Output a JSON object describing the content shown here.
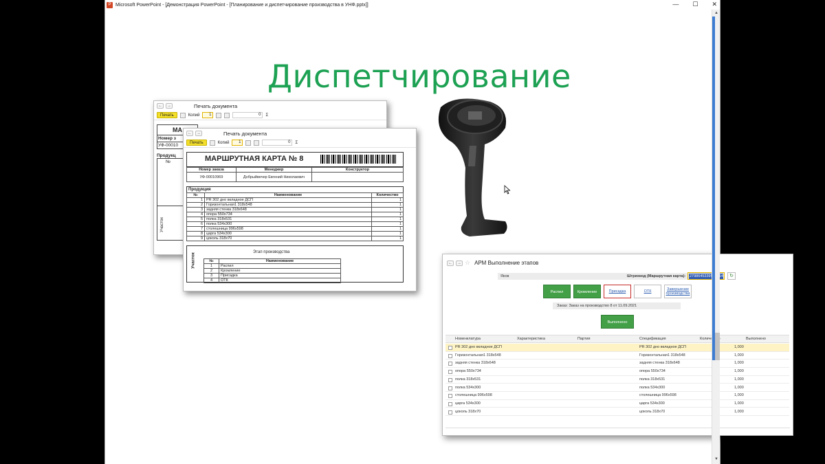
{
  "window": {
    "title": "Microsoft PowerPoint - [Демонстрация PowerPoint - [Планирование и диспетчирование производства в УНФ.pptx]]",
    "min": "—",
    "max": "☐",
    "close": "✕"
  },
  "slide": {
    "title": "Диспетчирование"
  },
  "doc_back": {
    "title": "Печать документа",
    "print_label": "Печать",
    "copies_label": "Копий",
    "copies": "1",
    "num": "0",
    "sigma": "Σ",
    "header_partial": "МА",
    "num_label": "Номер з",
    "order": "УФ-00010",
    "prod_label": "Продукц",
    "col_n": "№",
    "col_uch": "Участок"
  },
  "doc_front": {
    "title": "Печать документа",
    "print_label": "Печать",
    "copies_label": "Копий",
    "copies": "1",
    "num": "0",
    "sigma": "Σ",
    "heading": "МАРШРУТНАЯ КАРТА № 8",
    "order_head": "Номер заказа",
    "manager_head": "Менеджер",
    "constructor_head": "Конструктор",
    "order": "УФ-00010969",
    "manager": "Добрыйвечер Евгений Николаевич",
    "products_label": "Продукция",
    "col_n": "№",
    "col_name": "Наименование",
    "col_qty": "Количество",
    "products": [
      {
        "n": "1",
        "name": "PR 302 дно вкладное ДСП",
        "qty": "1"
      },
      {
        "n": "2",
        "name": "Горизонтальная1 318х548",
        "qty": "1"
      },
      {
        "n": "3",
        "name": "задняя стенка 318х648",
        "qty": "1"
      },
      {
        "n": "4",
        "name": "опора 550х734",
        "qty": "1"
      },
      {
        "n": "5",
        "name": "полка 318х531",
        "qty": "1"
      },
      {
        "n": "6",
        "name": "полка 534х300",
        "qty": "1"
      },
      {
        "n": "7",
        "name": "столешница 996х598",
        "qty": "1"
      },
      {
        "n": "8",
        "name": "царга 534х300",
        "qty": "1"
      },
      {
        "n": "9",
        "name": "цоколь 318х70",
        "qty": "1"
      }
    ],
    "uch_label": "Участок",
    "stage_label": "Этап производства",
    "stage_col_n": "№",
    "stage_col_name": "Наименование",
    "stages": [
      {
        "n": "1",
        "name": "Распил"
      },
      {
        "n": "2",
        "name": "Кромление"
      },
      {
        "n": "3",
        "name": "Присадка"
      },
      {
        "n": "4",
        "name": "ОТК"
      }
    ]
  },
  "arm": {
    "title": "АРМ Выполнение этапов",
    "user": "Яков",
    "barcode_label": "Штрихкод (Маршрутная карта):",
    "barcode_value": "2798645339577714",
    "buttons": [
      "Распил",
      "Кромление",
      "Присадка",
      "ОТК",
      "Завершение производства"
    ],
    "order_info": "Заказ: Заказ на производство 8 от 11.09.2021",
    "exec_button": "Выполнено",
    "cols": [
      "Номенклатура",
      "Характеристика",
      "Партия",
      "Спецификация",
      "Количество",
      "Выполнено"
    ],
    "rows": [
      {
        "name": "PR 302 дно вкладное ДСП",
        "spec": "PR 302 дно вкладное ДСП",
        "qty": "1,000"
      },
      {
        "name": "Горизонтальная1 318х548",
        "spec": "Горизонтальная1 318х548",
        "qty": "1,000"
      },
      {
        "name": "задняя стенка 318х648",
        "spec": "задняя стенка 318х648",
        "qty": "1,000"
      },
      {
        "name": "опора 550х734",
        "spec": "опора 550х734",
        "qty": "1,000"
      },
      {
        "name": "полка 318х531",
        "spec": "полка 318х531",
        "qty": "1,000"
      },
      {
        "name": "полка 534х300",
        "spec": "полка 534х300",
        "qty": "1,000"
      },
      {
        "name": "столешница 996х598",
        "spec": "столешница 996х598",
        "qty": "1,000"
      },
      {
        "name": "царга 534х300",
        "spec": "царга 534х300",
        "qty": "1,000"
      },
      {
        "name": "цоколь 318х70",
        "spec": "цоколь 318х70",
        "qty": "1,000"
      }
    ]
  },
  "colors": {
    "title_green": "#1da153",
    "button_green": "#43a047",
    "print_yellow": "#f3df2b",
    "scroll_blue": "#3d7cd1"
  }
}
